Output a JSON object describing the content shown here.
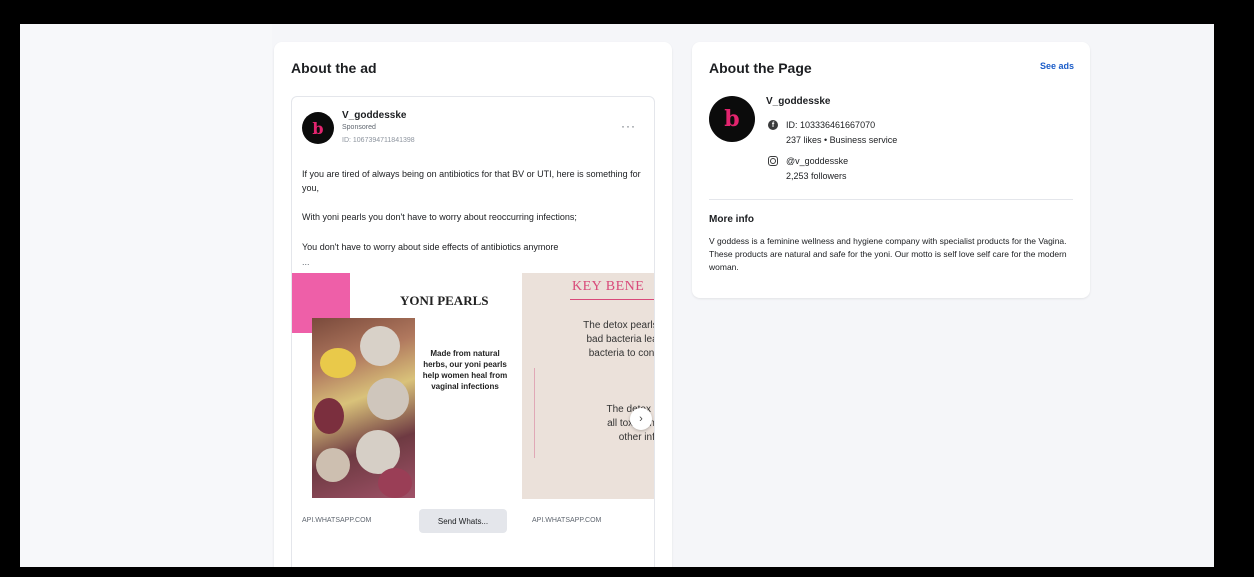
{
  "about_ad": {
    "title": "About the ad",
    "ad": {
      "page_name": "V_goddesske",
      "sponsored": "Sponsored",
      "library_id": "ID: 1067394711841398",
      "more": "···",
      "text_1": "If you are tired of always being on antibiotics for that BV or UTI, here is something for you,",
      "text_2": "With yoni pearls you don't have to worry about reoccurring infections;",
      "text_3": "You don't have to worry about side effects of antibiotics anymore",
      "text_more": "...",
      "slide_1": {
        "title": "YONI PEARLS",
        "body": "Made from natural herbs, our yoni pearls help women heal from vaginal infections"
      },
      "slide_2": {
        "title": "KEY BENE",
        "text_1": "The detox pearls pull\nbad bacteria leaving\nbacteria to continue\nwork",
        "text_2": "The detox pearl\nall toxin and wa\nother infectio"
      },
      "next_arrow": "›",
      "cta_url_1": "API.WHATSAPP.COM",
      "cta_button_1": "Send Whats...",
      "cta_url_2": "API.WHATSAPP.COM"
    }
  },
  "about_page": {
    "title": "About the Page",
    "see_ads": "See ads",
    "page_name": "V_goddesske",
    "facebook_id": "ID: 103336461667070",
    "facebook_stats": "237 likes • Business service",
    "instagram_handle": "@v_goddesske",
    "instagram_followers": "2,253 followers",
    "more_info_title": "More info",
    "more_info_text": "V goddess is a feminine wellness and hygiene company with specialist products for the Vagina. These products are natural and safe for the yoni. Our motto is self love self care for the modern woman."
  },
  "colors": {
    "brand_pink": "#e2246e",
    "link_blue": "#1a5cc8",
    "pink_block": "#ee5fa8"
  },
  "icons": {
    "facebook": "facebook-icon",
    "instagram": "instagram-icon",
    "more": "more-options-icon",
    "next": "chevron-right-icon"
  }
}
